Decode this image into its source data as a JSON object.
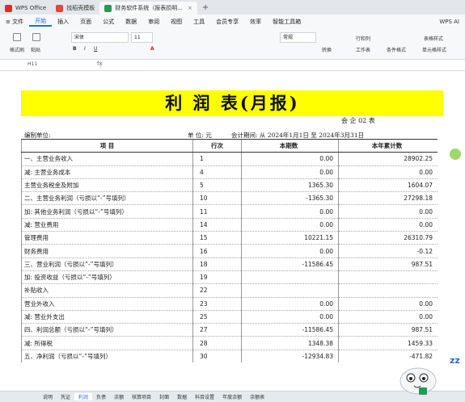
{
  "window": {
    "tabs": [
      {
        "label": "WPS Office",
        "color": "#d93025"
      },
      {
        "label": "找稻壳模板",
        "color": "#e8453c"
      },
      {
        "label": "财务软件系统（报表损明...",
        "color": "#1f9d55"
      }
    ],
    "plus": "+"
  },
  "menu": {
    "file": "≡ 文件",
    "items": [
      "开始",
      "插入",
      "页面",
      "公式",
      "数据",
      "审阅",
      "视图",
      "工具",
      "会员专享",
      "效率",
      "智能工具箱"
    ],
    "active": "开始",
    "wps_ai": "WPS AI"
  },
  "toolbar": {
    "format_painter": "格式刷",
    "paste": "粘贴",
    "font": "宋体",
    "size": "11",
    "number_format": "常规",
    "convert": "转换",
    "rows_cols": "行和列",
    "worksheet": "工作表",
    "cond_format": "条件格式",
    "cell_style": "单元格样式",
    "table_style": "表格样式"
  },
  "formula": {
    "name_box": "H11",
    "fx": "fx"
  },
  "report": {
    "title": "利 润 表(月报)",
    "code": "会 企 02 表",
    "unit_label": "编制单位:",
    "currency": "单 位: 元",
    "period": "会计期间: 从   2024年1月1日   至   2024年3月31日",
    "headers": [
      "项        目",
      "行次",
      "本期数",
      "本年累计数"
    ],
    "rows": [
      {
        "item": "一、主营业务收入",
        "no": "1",
        "cur": "0.00",
        "ytd": "28902.25"
      },
      {
        "item": "    减: 主营业务成本",
        "no": "4",
        "cur": "0.00",
        "ytd": "0.00"
      },
      {
        "item": "        主营业务税金及附加",
        "no": "5",
        "cur": "1365.30",
        "ytd": "1604.07"
      },
      {
        "item": "二、主营业务利润（亏损以“-”号填列）",
        "no": "10",
        "cur": "-1365.30",
        "ytd": "27298.18"
      },
      {
        "item": "    加: 其他业务利润（亏损以“-”号填列）",
        "no": "11",
        "cur": "0.00",
        "ytd": "0.00"
      },
      {
        "item": "    减:  营业费用",
        "no": "14",
        "cur": "0.00",
        "ytd": "0.00"
      },
      {
        "item": "                    管理费用",
        "no": "15",
        "cur": "10221.15",
        "ytd": "26310.79"
      },
      {
        "item": "                    财务费用",
        "no": "16",
        "cur": "0.00",
        "ytd": "-0.12"
      },
      {
        "item": "三、营业利润（亏损以“-”号填列）",
        "no": "18",
        "cur": "-11586.45",
        "ytd": "987.51"
      },
      {
        "item": "    加: 投资收益（亏损以“-”号填列）",
        "no": "19",
        "cur": "",
        "ytd": ""
      },
      {
        "item": "                   补贴收入",
        "no": "22",
        "cur": "",
        "ytd": ""
      },
      {
        "item": "                   营业外收入",
        "no": "23",
        "cur": "0.00",
        "ytd": "0.00"
      },
      {
        "item": "    减: 营业外支出",
        "no": "25",
        "cur": "0.00",
        "ytd": "0.00"
      },
      {
        "item": "四、利润总额（亏损以“-”号填列）",
        "no": "27",
        "cur": "-11586.45",
        "ytd": "987.51"
      },
      {
        "item": "    减: 所得税",
        "no": "28",
        "cur": "1348.38",
        "ytd": "1459.33"
      },
      {
        "item": "五、净利润（亏损以“-”号填列）",
        "no": "30",
        "cur": "-12934.83",
        "ytd": "-471.82"
      }
    ]
  },
  "sheet_tabs": [
    "说明",
    "凭证",
    "利润",
    "负债",
    "余额",
    "核算项目",
    "封面",
    "数据",
    "科目设置",
    "年度余额",
    "余额表"
  ],
  "active_sheet": "利润",
  "colors": {
    "accent": "#1a6fe0",
    "highlight": "#ffff00"
  }
}
